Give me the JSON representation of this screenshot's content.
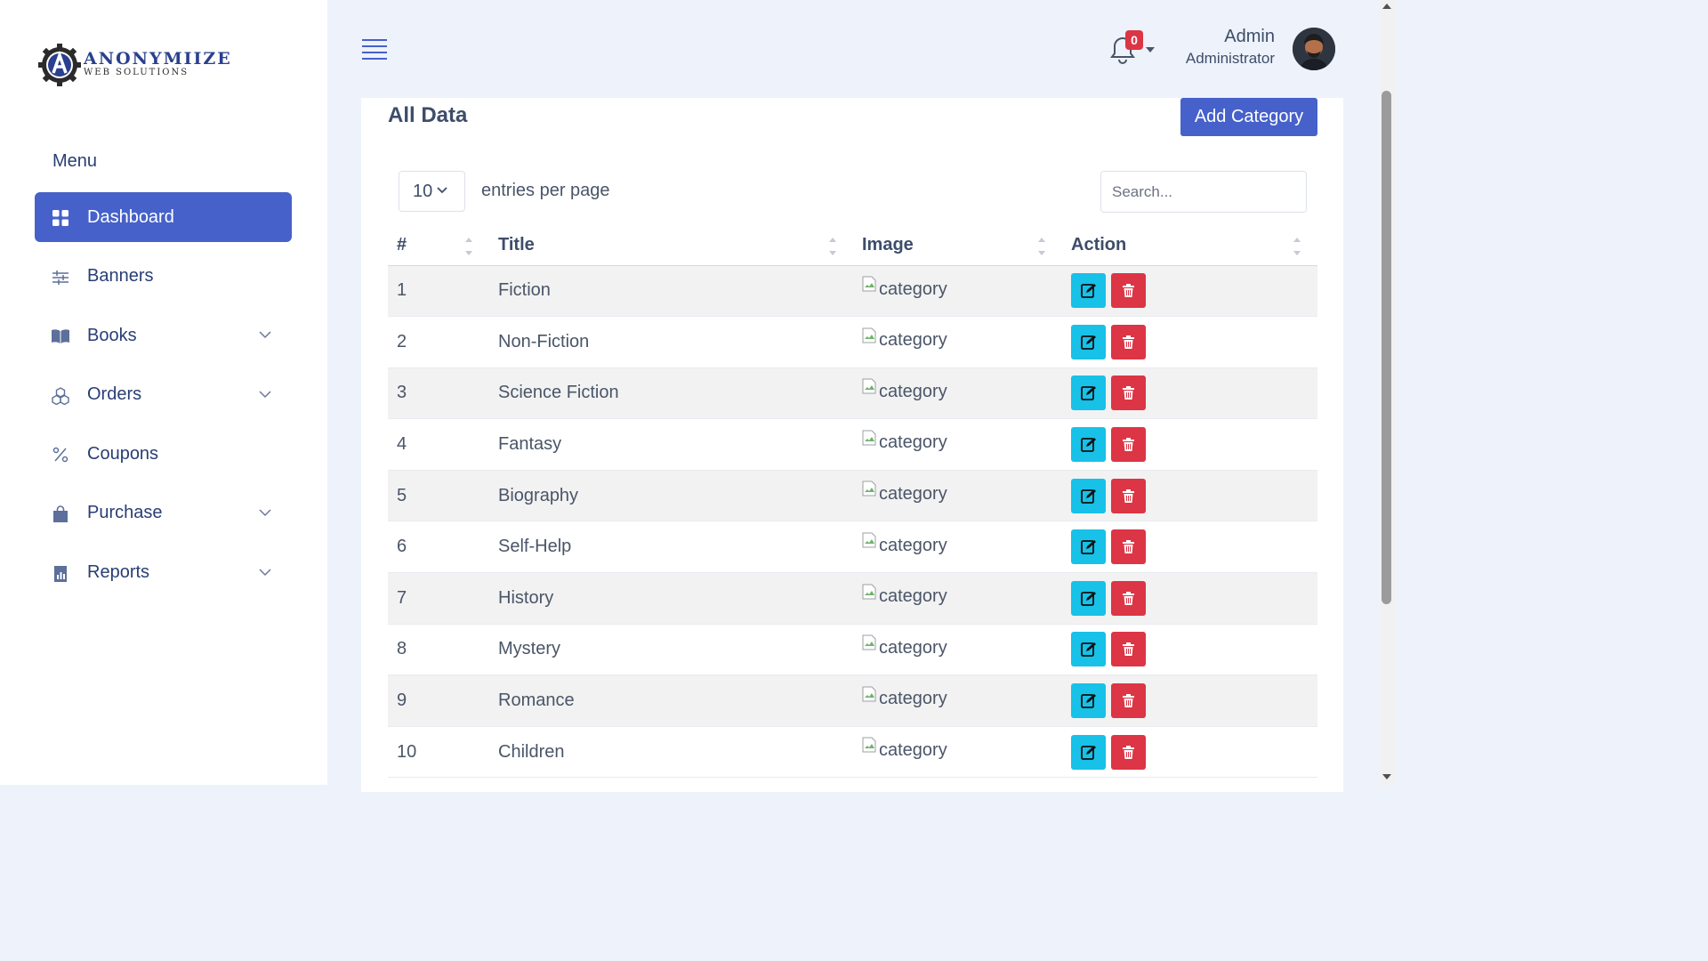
{
  "brand": {
    "name": "ANONYMIIZE",
    "sub": "WEB SOLUTIONS",
    "logo_icon": "gear-a-logo-icon"
  },
  "sidebar": {
    "menu_heading": "Menu",
    "items": [
      {
        "label": "Dashboard",
        "icon": "grid-icon",
        "active": true,
        "has_submenu": false
      },
      {
        "label": "Banners",
        "icon": "sliders-icon",
        "active": false,
        "has_submenu": false
      },
      {
        "label": "Books",
        "icon": "book-icon",
        "active": false,
        "has_submenu": true
      },
      {
        "label": "Orders",
        "icon": "boxes-icon",
        "active": false,
        "has_submenu": true
      },
      {
        "label": "Coupons",
        "icon": "percent-icon",
        "active": false,
        "has_submenu": false
      },
      {
        "label": "Purchase",
        "icon": "bag-icon",
        "active": false,
        "has_submenu": true
      },
      {
        "label": "Reports",
        "icon": "report-icon",
        "active": false,
        "has_submenu": true
      }
    ]
  },
  "header": {
    "notifications_count": "0",
    "user_name": "Admin",
    "user_role": "Administrator"
  },
  "main": {
    "title": "All Data",
    "add_button": "Add Category",
    "per_page_value": "10",
    "per_page_label": "entries per page",
    "search_placeholder": "Search...",
    "columns": [
      "#",
      "Title",
      "Image",
      "Action"
    ],
    "image_alt": "category",
    "rows": [
      {
        "num": "1",
        "title": "Fiction"
      },
      {
        "num": "2",
        "title": "Non-Fiction"
      },
      {
        "num": "3",
        "title": "Science Fiction"
      },
      {
        "num": "4",
        "title": "Fantasy"
      },
      {
        "num": "5",
        "title": "Biography"
      },
      {
        "num": "6",
        "title": "Self-Help"
      },
      {
        "num": "7",
        "title": "History"
      },
      {
        "num": "8",
        "title": "Mystery"
      },
      {
        "num": "9",
        "title": "Romance"
      },
      {
        "num": "10",
        "title": "Children"
      }
    ]
  },
  "colors": {
    "primary": "#4661c9",
    "edit": "#17c1e8",
    "delete": "#dc3545",
    "background": "#eef2fb"
  }
}
